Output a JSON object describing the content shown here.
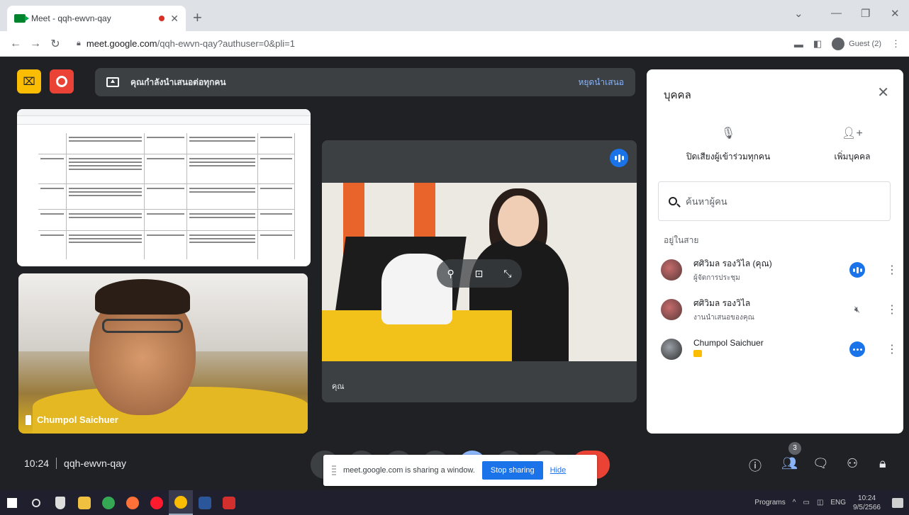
{
  "browser": {
    "tab_title": "Meet - qqh-ewvn-qay",
    "url_host": "meet.google.com",
    "url_path": "/qqh-ewvn-qay?authuser=0&pli=1",
    "profile_label": "Guest (2)"
  },
  "presentation": {
    "banner_text": "คุณกำลังนำเสนอต่อทุกคน",
    "stop_label": "หยุดนำเสนอ"
  },
  "tiles": {
    "man_name": "Chumpol Saichuer",
    "woman_label": "คุณ"
  },
  "people_panel": {
    "title": "บุคคล",
    "mute_all_label": "ปิดเสียงผู้เข้าร่วมทุกคน",
    "add_people_label": "เพิ่มบุคคล",
    "search_placeholder": "ค้นหาผู้คน",
    "section_label": "อยู่ในสาย",
    "participants": [
      {
        "name": "ศศิวิมล รองวิไล (คุณ)",
        "subtitle": "ผู้จัดการประชุม"
      },
      {
        "name": "ศศิวิมล รองวิไล",
        "subtitle": "งานนำเสนอของคุณ"
      },
      {
        "name": "Chumpol Saichuer",
        "subtitle": ""
      }
    ]
  },
  "bottom_bar": {
    "time": "10:24",
    "meeting_code": "qqh-ewvn-qay",
    "people_count": "3"
  },
  "share_bar": {
    "message": "meet.google.com is sharing a window.",
    "stop_label": "Stop sharing",
    "hide_label": "Hide"
  },
  "taskbar": {
    "programs_label": "Programs",
    "lang": "ENG",
    "clock_time": "10:24",
    "clock_date": "9/5/2566"
  }
}
